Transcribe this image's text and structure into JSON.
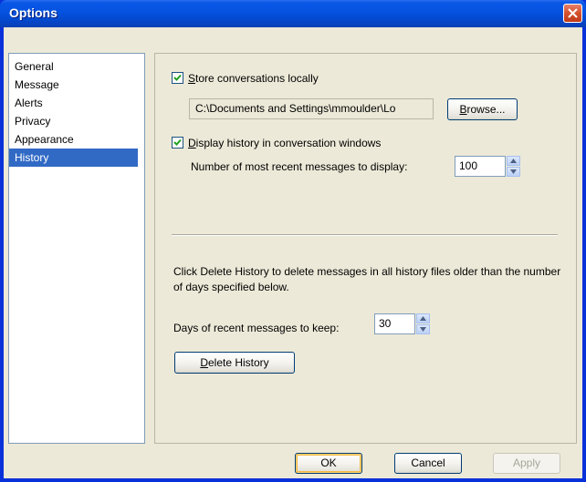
{
  "window": {
    "title": "Options"
  },
  "sidebar": {
    "items": [
      {
        "label": "General"
      },
      {
        "label": "Message"
      },
      {
        "label": "Alerts"
      },
      {
        "label": "Privacy"
      },
      {
        "label": "Appearance"
      },
      {
        "label": "History"
      }
    ],
    "selected": "History"
  },
  "history": {
    "store_locally": {
      "label_u": "S",
      "label_rest": "tore conversations locally",
      "checked": true
    },
    "path_value": "C:\\Documents and Settings\\mmoulder\\Lo",
    "browse_label_u": "B",
    "browse_label_rest": "rowse...",
    "display_history": {
      "label_u": "D",
      "label_rest": "isplay history in conversation windows",
      "checked": true
    },
    "recent_label": "Number of most recent messages to display:",
    "recent_value": "100",
    "delete_description": "Click Delete History to delete messages in all history files older than the number of days specified below.",
    "days_label": "Days of recent messages to keep:",
    "days_value": "30",
    "delete_label_u": "D",
    "delete_label_rest": "elete History"
  },
  "footer": {
    "ok_label": "OK",
    "cancel_label": "Cancel",
    "apply_label": "Apply"
  }
}
